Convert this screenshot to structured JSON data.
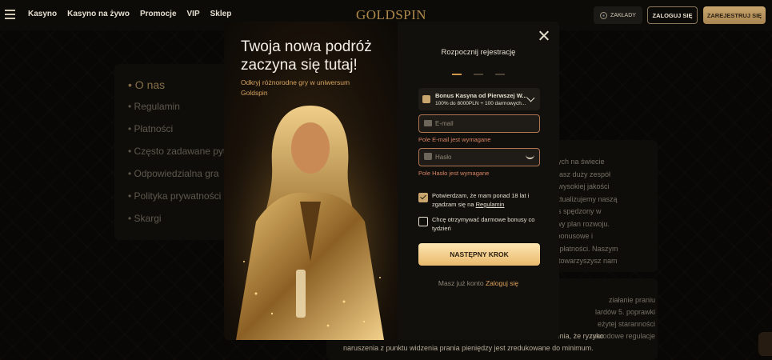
{
  "header": {
    "nav": [
      "Kasyno",
      "Kasyno na żywo",
      "Promocje",
      "VIP",
      "Sklep"
    ],
    "logo": "GOLDSPIN",
    "bets_label": "ZAKŁADY",
    "login_label": "ZALOGUJ SIĘ",
    "register_label": "ZAREJESTRUJ SIĘ"
  },
  "sidebar": {
    "items": [
      "• O nas",
      "• Regulamin",
      "• Płatności",
      "• Często zadawane pyt",
      "• Odpowiedzialna gra",
      "• Polityka prywatności",
      "• Skargi"
    ]
  },
  "content": {
    "card1_lines": [
      "lepszych na świecie",
      "rdu, nasz duży zespół",
      "jemy wysokiej jakości",
      "nie aktualizujemy naszą",
      "y czas spędzony w",
      "ofalowy plan rozwoju.",
      "amy bonusowe i",
      "zację płatności. Naszym",
      "e, że towarzyszysz nam"
    ],
    "card2_lines": [
      "ziałanie praniu",
      "lardów 5. poprawki",
      "eżytej staranności",
      "marodowe regulacje"
    ],
    "card2_foot": [
      "Aml, jak również wdraża jasne procedury i procesy w celu zapewnienia, że ryzyko",
      "naruszenia z punktu widzenia prania pieniędzy jest zredukowane do minimum."
    ]
  },
  "modal": {
    "title": "Twoja nowa podróż zaczyna się tutaj!",
    "subtitle": "Odkryj różnorodne gry w uniwersum Goldspin",
    "reg_title": "Rozpocznij rejestrację",
    "steps_active": 1,
    "bonus_title": "Bonus Kasyna od Pierwszej W...",
    "bonus_sub": "100% do 8000PLN + 100 darmowych...",
    "email_placeholder": "E-mail",
    "email_error": "Pole E-mail jest wymagane",
    "password_placeholder": "Hasło",
    "password_error": "Pole Hasło jest wymagane",
    "confirm_text": "Potwierdzam, że mam ponad 18 lat i zgadzam się na ",
    "confirm_link": "Regulamin",
    "bonus_opt_text": "Chcę otrzymywać darmowe bonusy co tydzień",
    "next_label": "NASTĘPNY KROK",
    "already_text": "Masz już konto ",
    "login_link": "Zaloguj się"
  },
  "colors": {
    "accent": "#c9a66d",
    "error": "#d98462",
    "button": "#e9b96c"
  }
}
